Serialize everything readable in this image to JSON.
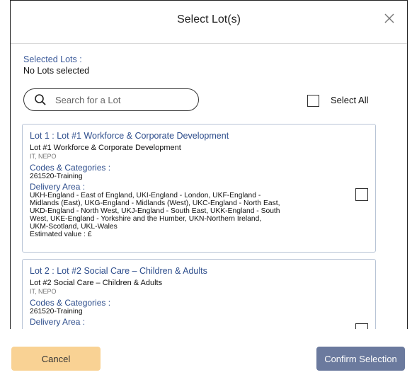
{
  "modal": {
    "title": "Select Lot(s)",
    "close_icon": "close-icon"
  },
  "selected": {
    "label": "Selected Lots :",
    "value": "No Lots selected"
  },
  "search": {
    "placeholder": "Search for a Lot",
    "icon": "search-icon"
  },
  "select_all": {
    "label": "Select All",
    "checked": false
  },
  "lots": [
    {
      "title": "Lot 1 : Lot #1 Workforce & Corporate Development",
      "name": "Lot #1 Workforce & Corporate Development",
      "tags": "IT, NEPO",
      "codes_label": "Codes & Categories :",
      "codes": "261520-Training",
      "delivery_label": "Delivery Area :",
      "delivery_lines": [
        "UKH-England - East of England, UKI-England - London, UKF-England -",
        "Midlands (East), UKG-England - Midlands (West), UKC-England - North East,",
        "UKD-England - North West, UKJ-England - South East, UKK-England - South",
        "West, UKE-England - Yorkshire and the Humber, UKN-Northern Ireland,",
        "UKM-Scotland, UKL-Wales"
      ],
      "estimated": "Estimated value : £",
      "checked": false
    },
    {
      "title": "Lot 2 : Lot #2 Social Care – Children & Adults",
      "name": "Lot #2 Social Care – Children & Adults",
      "tags": "IT, NEPO",
      "codes_label": "Codes & Categories :",
      "codes": "261520-Training",
      "delivery_label": "Delivery Area :",
      "checked": false
    }
  ],
  "buttons": {
    "cancel": "Cancel",
    "confirm": "Confirm Selection"
  },
  "colors": {
    "accent_text": "#2d4d8c",
    "cancel_bg": "#f9d294",
    "confirm_bg": "#6b7a9e"
  }
}
